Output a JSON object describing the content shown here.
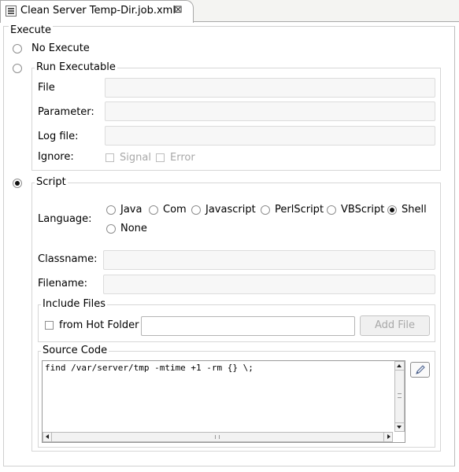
{
  "tab": {
    "title": "Clean Server Temp-Dir.job.xml",
    "close_glyph": "⊠"
  },
  "execute": {
    "legend": "Execute",
    "no_execute_label": "No Execute",
    "run_executable": {
      "legend": "Run Executable",
      "file_label": "File",
      "file_value": "",
      "parameter_label": "Parameter:",
      "parameter_value": "",
      "logfile_label": "Log file:",
      "logfile_value": "",
      "ignore_label": "Ignore:",
      "signal_label": "Signal",
      "error_label": "Error"
    },
    "script": {
      "legend": "Script",
      "language_label": "Language:",
      "languages": [
        "Java",
        "Com",
        "Javascript",
        "PerlScript",
        "VBScript",
        "Shell",
        "None"
      ],
      "selected_language": "Shell",
      "classname_label": "Classname:",
      "classname_value": "",
      "filename_label": "Filename:",
      "filename_value": "",
      "include_files": {
        "legend": "Include Files",
        "from_hot_folder_label": "from Hot Folder",
        "hot_folder_value": "",
        "add_file_label": "Add File"
      },
      "source_code": {
        "legend": "Source Code",
        "text": "find /var/server/tmp -mtime +1 -rm {} \\;"
      }
    },
    "selected_mode": "Script"
  },
  "icons": {
    "tab": "xml-file-icon",
    "edit": "pencil-icon",
    "scroll_up": "arrow-up-icon",
    "scroll_down": "arrow-down-icon",
    "scroll_left": "arrow-left-icon",
    "scroll_right": "arrow-right-icon"
  }
}
